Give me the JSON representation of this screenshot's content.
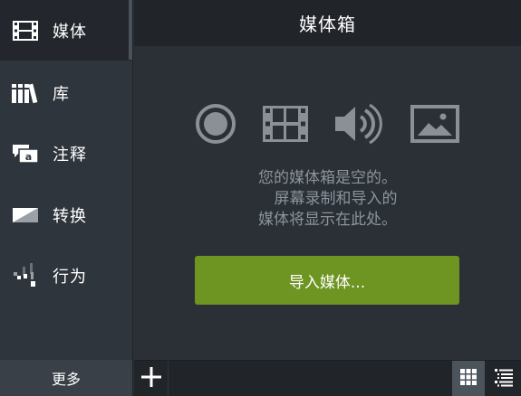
{
  "sidebar": {
    "items": [
      {
        "label": "媒体",
        "icon": "film-icon"
      },
      {
        "label": "库",
        "icon": "library-books-icon"
      },
      {
        "label": "注释",
        "icon": "annotation-bubble-icon"
      },
      {
        "label": "转换",
        "icon": "transition-icon"
      },
      {
        "label": "行为",
        "icon": "behavior-icon"
      }
    ],
    "more_label": "更多"
  },
  "main": {
    "title": "媒体箱",
    "empty_message": {
      "line1": "您的媒体箱是空的。",
      "line2": "屏幕录制和导入的",
      "line3": "媒体将显示在此处。"
    },
    "import_button_label": "导入媒体..."
  },
  "colors": {
    "accent_green": "#6e9422",
    "sidebar_bg": "#2f353c",
    "main_bg": "#2a3036",
    "header_bg": "#212529",
    "icon_gray": "#8a9096"
  }
}
